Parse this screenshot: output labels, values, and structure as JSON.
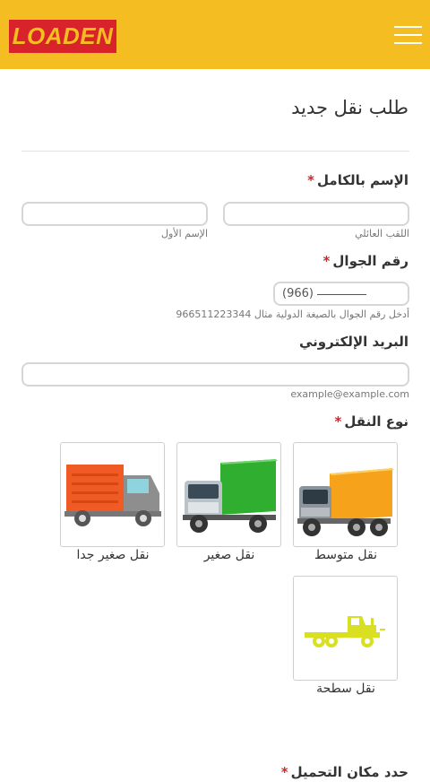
{
  "header": {
    "logo_text": "LOADEN"
  },
  "form": {
    "title": "طلب نقل جديد",
    "full_name": {
      "label": "الإسم بالكامل",
      "required_mark": "*",
      "last_name_hint": "اللقب العائلي",
      "first_name_hint": "الإسم الأول"
    },
    "phone": {
      "label": "رقم الجوال",
      "required_mark": "*",
      "prefix": "(966)",
      "hint": "أدخل رقم الجوال بالصيغة الدولية مثال 966511223344"
    },
    "email": {
      "label": "البريد الإلكتروني",
      "hint": "example@example.com"
    },
    "transport_type": {
      "label": "نوع النقل",
      "required_mark": "*",
      "options": [
        {
          "label": "نقل متوسط",
          "icon": "orange-truck-icon"
        },
        {
          "label": "نقل صغير",
          "icon": "green-truck-icon"
        },
        {
          "label": "نقل صغير جدا",
          "icon": "red-truck-icon"
        },
        {
          "label": "نقل سطحة",
          "icon": "flatbed-truck-icon"
        }
      ]
    },
    "loading_location": {
      "label": "حدد مكان التحميل",
      "required_mark": "*"
    }
  },
  "colors": {
    "brand_yellow": "#f4bd22",
    "brand_red": "#d8232a"
  }
}
